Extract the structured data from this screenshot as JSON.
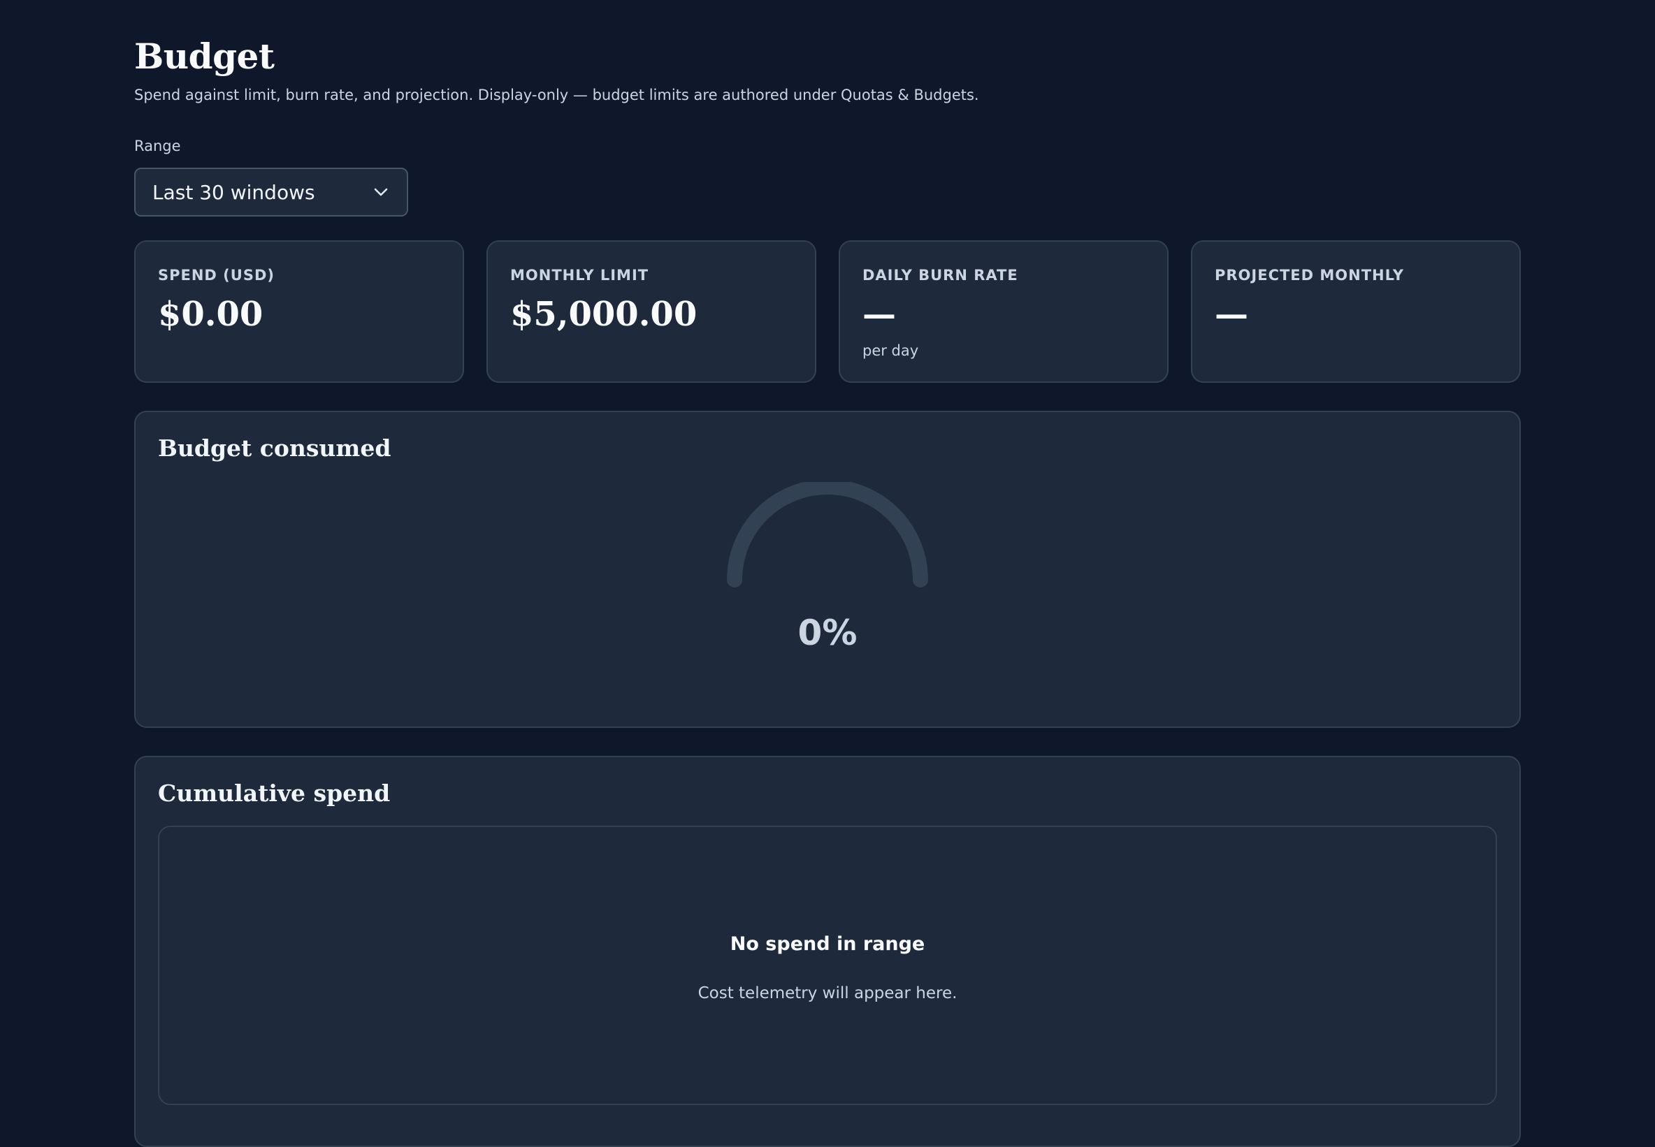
{
  "header": {
    "title": "Budget",
    "subtitle": "Spend against limit, burn rate, and projection. Display-only — budget limits are authored under Quotas & Budgets."
  },
  "range": {
    "label": "Range",
    "selected": "Last 30 windows"
  },
  "cards": [
    {
      "label": "SPEND (USD)",
      "value": "$0.00",
      "sub": ""
    },
    {
      "label": "MONTHLY LIMIT",
      "value": "$5,000.00",
      "sub": ""
    },
    {
      "label": "DAILY BURN RATE",
      "value": "—",
      "sub": "per day"
    },
    {
      "label": "PROJECTED MONTHLY",
      "value": "—",
      "sub": ""
    }
  ],
  "budget_consumed": {
    "title": "Budget consumed",
    "percent_label": "0%",
    "fraction": 0
  },
  "cumulative_spend": {
    "title": "Cumulative spend",
    "empty_title": "No spend in range",
    "empty_sub": "Cost telemetry will appear here."
  },
  "colors": {
    "background": "#0f172a",
    "card": "#1e293b",
    "border": "#334155",
    "gauge_track": "#334155"
  },
  "icons": {
    "range_select": "chevron-down-icon"
  }
}
